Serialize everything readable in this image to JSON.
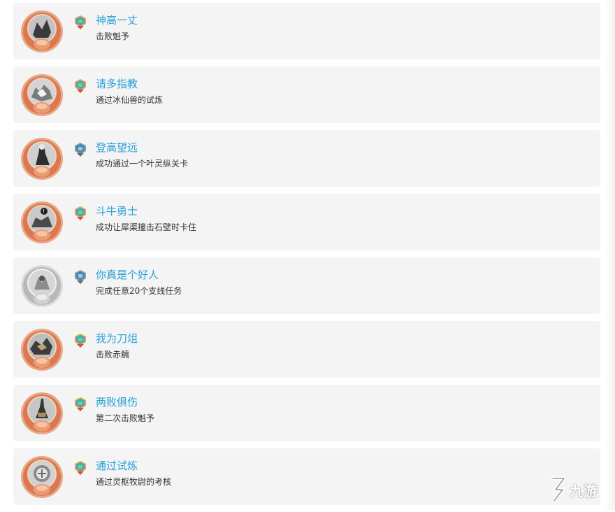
{
  "achievements": [
    {
      "title": "神高一丈",
      "desc": "击败魁予",
      "medal": "bronze-medal-icon",
      "badge": "color-badge-icon"
    },
    {
      "title": "请多指教",
      "desc": "通过冰仙兽的试炼",
      "medal": "bronze-medal-icon",
      "badge": "color-badge-icon"
    },
    {
      "title": "登高望远",
      "desc": "成功通过一个叶灵纵关卡",
      "medal": "bronze-medal-icon",
      "badge": "gray-badge-icon"
    },
    {
      "title": "斗牛勇士",
      "desc": "成功让犀渠撞击石壁时卡住",
      "medal": "bronze-medal-icon",
      "badge": "color-badge-icon"
    },
    {
      "title": "你真是个好人",
      "desc": "完成任意20个支线任务",
      "medal": "silver-medal-icon",
      "badge": "gray-badge-icon"
    },
    {
      "title": "我为刀俎",
      "desc": "击败赤鱬",
      "medal": "bronze-medal-icon",
      "badge": "color-badge-icon"
    },
    {
      "title": "两败俱伤",
      "desc": "第二次击败魁予",
      "medal": "bronze-medal-icon",
      "badge": "color-badge-icon"
    },
    {
      "title": "通过试炼",
      "desc": "通过灵枢牧尉的考核",
      "medal": "bronze-medal-icon",
      "badge": "color-badge-icon"
    }
  ],
  "watermark": {
    "text": "九游",
    "icon": "9game-logo-icon"
  },
  "colors": {
    "title": "#2a9fd8",
    "desc": "#333333",
    "card_bg": "#f4f4f4",
    "bronze": "#d9794f",
    "silver": "#b8b8b8"
  }
}
